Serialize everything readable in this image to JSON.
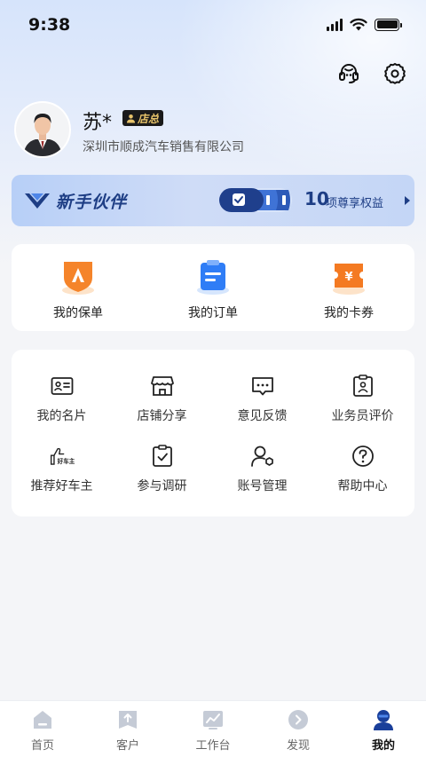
{
  "status_bar": {
    "time": "9:38"
  },
  "user": {
    "name": "苏*",
    "role_badge": "店总",
    "company": "深圳市顺成汽车销售有限公司"
  },
  "banner": {
    "title": "新手伙伴",
    "count": "10",
    "desc": "项尊享权益"
  },
  "quick_links": [
    {
      "label": "我的保单",
      "icon": "policy-shield-icon"
    },
    {
      "label": "我的订单",
      "icon": "order-clipboard-icon"
    },
    {
      "label": "我的卡券",
      "icon": "coupon-ticket-icon"
    }
  ],
  "tools": [
    {
      "label": "我的名片",
      "icon": "business-card-icon"
    },
    {
      "label": "店铺分享",
      "icon": "store-icon"
    },
    {
      "label": "意见反馈",
      "icon": "feedback-icon"
    },
    {
      "label": "业务员评价",
      "icon": "rating-badge-icon"
    },
    {
      "label": "推荐好车主",
      "icon": "thumbs-up-icon",
      "icon_text": "好车主"
    },
    {
      "label": "参与调研",
      "icon": "survey-clipboard-icon"
    },
    {
      "label": "账号管理",
      "icon": "account-settings-icon"
    },
    {
      "label": "帮助中心",
      "icon": "help-icon"
    }
  ],
  "tabbar": [
    {
      "label": "首页",
      "icon": "home-icon"
    },
    {
      "label": "客户",
      "icon": "customer-upload-icon"
    },
    {
      "label": "工作台",
      "icon": "workbench-chart-icon"
    },
    {
      "label": "发现",
      "icon": "discover-arrow-icon"
    },
    {
      "label": "我的",
      "icon": "profile-person-icon",
      "active": true
    }
  ],
  "colors": {
    "accent_blue": "#1e3e85",
    "orange": "#f5842a",
    "brand_blue": "#2f7df6",
    "tab_icon": "#c5cbd6",
    "tab_active_icon": "#1a3f9a"
  }
}
